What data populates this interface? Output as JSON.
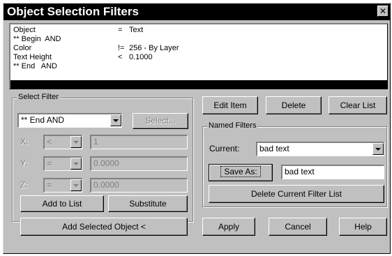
{
  "window": {
    "title": "Object Selection Filters",
    "close_glyph": "✕"
  },
  "filter_list": [
    {
      "a": "Object",
      "b": "=",
      "c": "Text"
    },
    {
      "a": "** Begin  AND",
      "b": "",
      "c": ""
    },
    {
      "a": "Color",
      "b": "!=",
      "c": "256 - By Layer"
    },
    {
      "a": "Text Height",
      "b": "<",
      "c": "0.1000"
    },
    {
      "a": "** End   AND",
      "b": "",
      "c": ""
    }
  ],
  "select_filter": {
    "group_label": "Select Filter",
    "type_value": "** End   AND",
    "select_label": "Select...",
    "x": {
      "label": "X:",
      "op": "<",
      "value": "1"
    },
    "y": {
      "label": "Y:",
      "op": "=",
      "value": "0.0000"
    },
    "z": {
      "label": "Z:",
      "op": "=",
      "value": "0.0000"
    },
    "add_to_list": "Add to List",
    "substitute": "Substitute",
    "add_selected": "Add Selected Object <"
  },
  "list_buttons": {
    "edit_item": "Edit Item",
    "delete": "Delete",
    "clear_list": "Clear List"
  },
  "named_filters": {
    "group_label": "Named Filters",
    "current_label": "Current:",
    "current_value": "bad text",
    "save_as_label": "Save As:",
    "save_as_value": "bad text",
    "delete_current": "Delete Current Filter List"
  },
  "footer": {
    "apply": "Apply",
    "cancel": "Cancel",
    "help": "Help"
  }
}
